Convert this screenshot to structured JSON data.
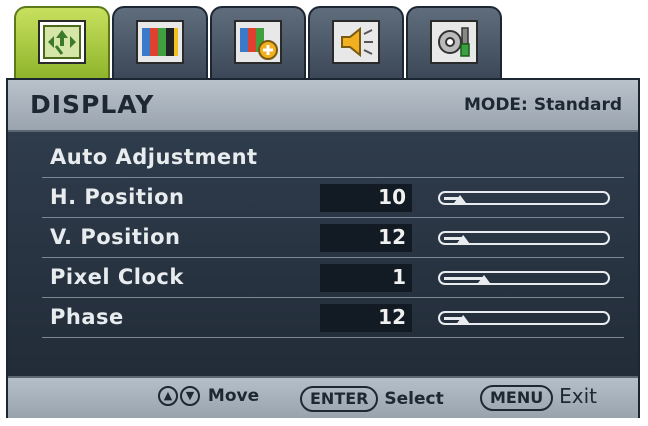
{
  "tabs": [
    {
      "name": "display",
      "icon": "display-settings-icon"
    },
    {
      "name": "picture",
      "icon": "picture-icon"
    },
    {
      "name": "picture-advanced",
      "icon": "picture-advanced-icon"
    },
    {
      "name": "audio",
      "icon": "speaker-icon"
    },
    {
      "name": "system",
      "icon": "system-settings-icon"
    }
  ],
  "header": {
    "title": "DISPLAY",
    "mode_label": "MODE:",
    "mode_value": "Standard"
  },
  "menu": {
    "auto_adjust_label": "Auto Adjustment",
    "items": [
      {
        "label": "H. Position",
        "value": "10",
        "level": 0.1
      },
      {
        "label": "V. Position",
        "value": "12",
        "level": 0.12
      },
      {
        "label": "Pixel Clock",
        "value": "1",
        "level": 0.25
      },
      {
        "label": "Phase",
        "value": "12",
        "level": 0.12
      }
    ]
  },
  "footer": {
    "move_label": "Move",
    "enter_key": "ENTER",
    "select_label": "Select",
    "menu_key": "MENU",
    "exit_label": "Exit"
  },
  "colors": {
    "active_tab": "#a8c83c",
    "panel": "#25313f",
    "bar": "#a8b2bc"
  }
}
